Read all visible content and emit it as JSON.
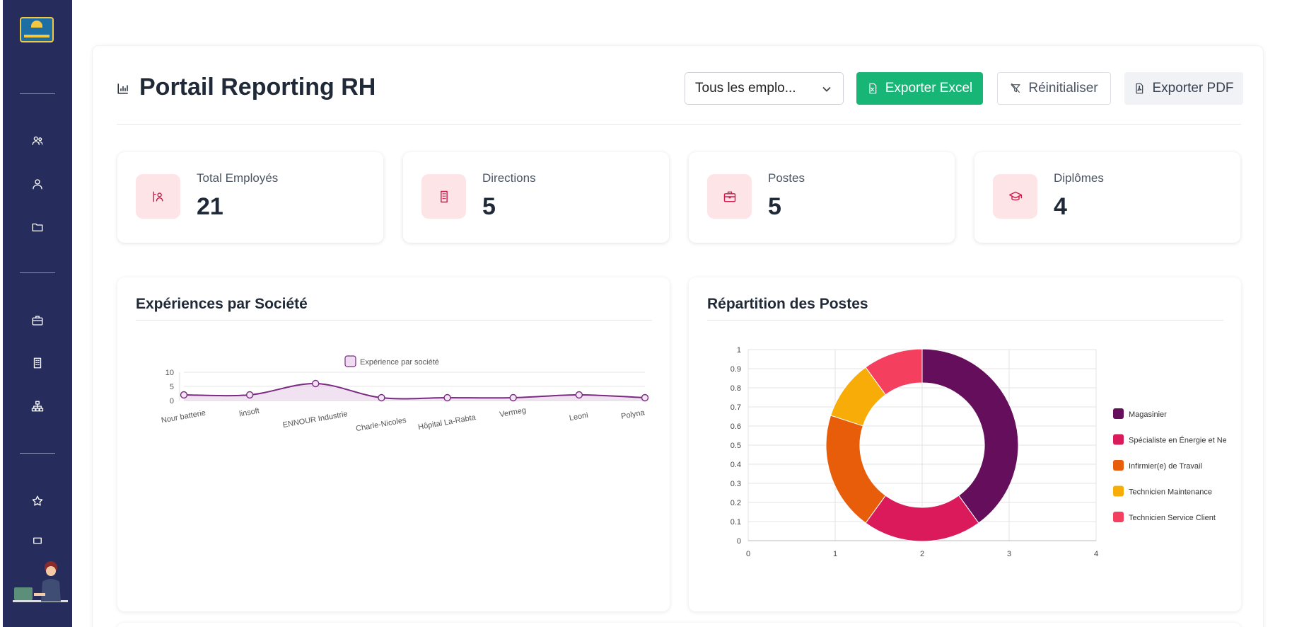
{
  "sidebar": {
    "items": [
      {
        "icon": "users-icon"
      },
      {
        "icon": "user-icon"
      },
      {
        "icon": "folder-icon"
      },
      {
        "icon": "briefcase-icon"
      },
      {
        "icon": "building-icon"
      },
      {
        "icon": "org-chart-icon"
      },
      {
        "icon": "star-icon"
      },
      {
        "icon": "bookmark-icon"
      }
    ]
  },
  "header": {
    "title": "Portail Reporting RH",
    "employee_filter": "Tous les emplo...",
    "export_excel": "Exporter Excel",
    "reset": "Réinitialiser",
    "export_pdf": "Exporter PDF"
  },
  "stats": [
    {
      "label": "Total Employés",
      "value": "21",
      "icon": "employees-icon"
    },
    {
      "label": "Directions",
      "value": "5",
      "icon": "building-icon"
    },
    {
      "label": "Postes",
      "value": "5",
      "icon": "briefcase-icon"
    },
    {
      "label": "Diplômes",
      "value": "4",
      "icon": "graduation-cap-icon"
    }
  ],
  "charts": {
    "experiences_title": "Expériences par Société",
    "postes_title": "Répartition des Postes"
  },
  "colors": {
    "sidebar": "#262c5c",
    "accent_green": "#17b677",
    "stat_icon_bg": "#fde4e7",
    "stat_icon_fg": "#d11a4a",
    "line_series": "#7b2a82"
  },
  "chart_data": [
    {
      "type": "line",
      "title": "Expériences par Société",
      "categories": [
        "Nour batterie",
        "linsoft",
        "ENNOUR Industrie",
        "Charle-Nicoles",
        "Hôpital La-Rabta",
        "Vermeg",
        "Leoni",
        "Polyna"
      ],
      "series": [
        {
          "name": "Expérience par société",
          "values": [
            2,
            2,
            6,
            1,
            1,
            1,
            2,
            1
          ]
        }
      ],
      "yticks": [
        "0",
        "5",
        "10"
      ],
      "ylim": [
        0,
        10
      ],
      "area_fill": true,
      "legend": "top"
    },
    {
      "type": "pie",
      "title": "Répartition des Postes",
      "donut": true,
      "labels": [
        "Magasinier",
        "Spécialiste en Énergie et Ne",
        "Infirmier(e) de Travail",
        "Technicien Maintenance",
        "Technicien Service Client"
      ],
      "values": [
        8,
        4,
        4,
        2,
        2
      ],
      "colors": [
        "#650f5c",
        "#db1a5c",
        "#e85d0a",
        "#f8ac07",
        "#f43f5e"
      ],
      "yticks": [
        "0",
        "0.1",
        "0.2",
        "0.3",
        "0.4",
        "0.5",
        "0.6",
        "0.7",
        "0.8",
        "0.9",
        "1"
      ],
      "xticks": [
        "0",
        "1",
        "2",
        "3",
        "4"
      ],
      "ylim": [
        0,
        1
      ],
      "xlim": [
        0,
        4
      ],
      "grid": true,
      "legend": "right"
    }
  ]
}
